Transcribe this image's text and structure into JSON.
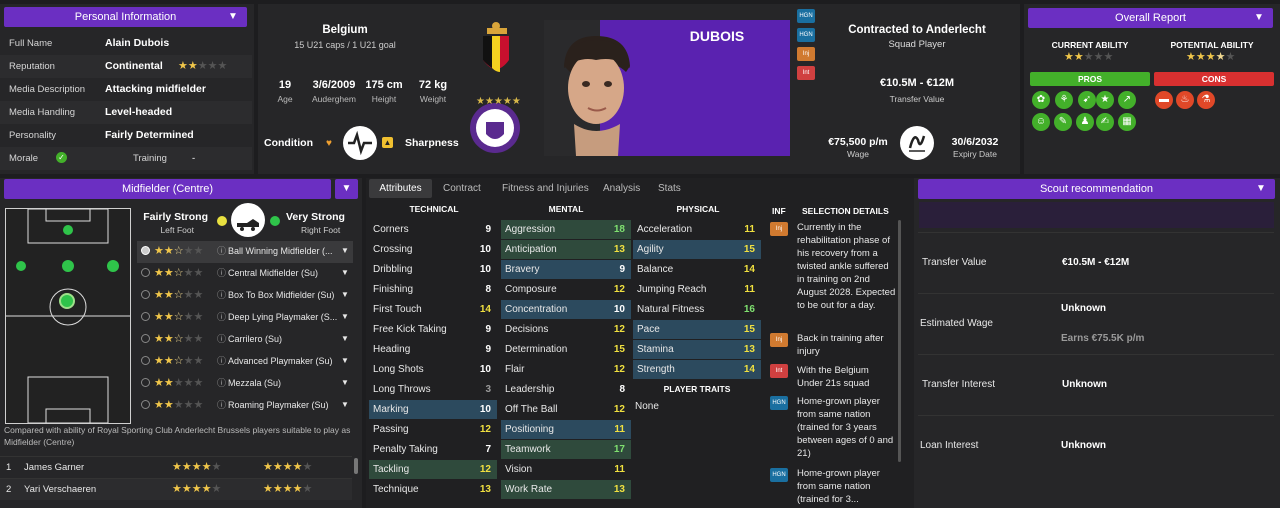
{
  "personal": {
    "title": "Personal Information",
    "rows": [
      {
        "k": "Full Name",
        "v": "Alain Dubois"
      },
      {
        "k": "Reputation",
        "v": "Continental"
      },
      {
        "k": "Media Description",
        "v": "Attacking midfielder"
      },
      {
        "k": "Media Handling",
        "v": "Level-headed"
      },
      {
        "k": "Personality",
        "v": "Fairly Determined"
      }
    ],
    "morale_label": "Morale",
    "training_label": "Training",
    "training_value": "-"
  },
  "header": {
    "nation": "Belgium",
    "caps": "15 U21 caps / 1 U21 goal",
    "age": "19",
    "age_label": "Age",
    "dob": "3/6/2009",
    "birthplace": "Auderghem",
    "height": "175 cm",
    "height_label": "Height",
    "weight": "72 kg",
    "weight_label": "Weight",
    "condition_label": "Condition",
    "sharpness_label": "Sharpness",
    "surname": "DUBOIS",
    "contract": "Contracted to Anderlecht",
    "squad": "Squad Player",
    "value": "€10.5M - €12M",
    "value_label": "Transfer Value",
    "wage": "€75,500 p/m",
    "wage_label": "Wage",
    "expiry": "30/6/2032",
    "expiry_label": "Expiry Date",
    "badges": [
      "HGN",
      "HGN",
      "Inj",
      "Int"
    ]
  },
  "report": {
    "title": "Overall Report",
    "ca_label": "CURRENT ABILITY",
    "pa_label": "POTENTIAL ABILITY",
    "pros_label": "PROS",
    "cons_label": "CONS",
    "ca_stars": 2,
    "pa_stars": 3.5
  },
  "position": {
    "title": "Midfielder (Centre)",
    "left_foot_level": "Fairly Strong",
    "left_foot": "Left Foot",
    "right_foot_level": "Very Strong",
    "right_foot": "Right Foot",
    "roles": [
      {
        "name": "Ball Winning Midfielder (...",
        "stars": 2.5
      },
      {
        "name": "Central Midfielder (Su)",
        "stars": 2.5
      },
      {
        "name": "Box To Box Midfielder (Su)",
        "stars": 2.5
      },
      {
        "name": "Deep Lying Playmaker (S...",
        "stars": 2.5
      },
      {
        "name": "Carrilero (Su)",
        "stars": 2.5
      },
      {
        "name": "Advanced Playmaker (Su)",
        "stars": 2.5
      },
      {
        "name": "Mezzala (Su)",
        "stars": 2
      },
      {
        "name": "Roaming Playmaker (Su)",
        "stars": 2
      }
    ],
    "compare": "Compared with ability of Royal Sporting Club Anderlecht Brussels players suitable to play as Midfielder (Centre)",
    "comparisons": [
      {
        "rank": "1",
        "name": "James Garner",
        "a": 4,
        "b": 4
      },
      {
        "rank": "2",
        "name": "Yari Verschaeren",
        "a": 4,
        "b": 4
      }
    ]
  },
  "tabs": [
    "Attributes",
    "Contract",
    "Fitness and Injuries",
    "Analysis",
    "Stats"
  ],
  "attributes": {
    "tech_title": "TECHNICAL",
    "mental_title": "MENTAL",
    "phys_title": "PHYSICAL",
    "traits_title": "PLAYER TRAITS",
    "traits": "None",
    "technical": [
      [
        "Corners",
        "9"
      ],
      [
        "Crossing",
        "10"
      ],
      [
        "Dribbling",
        "10"
      ],
      [
        "Finishing",
        "8"
      ],
      [
        "First Touch",
        "14"
      ],
      [
        "Free Kick Taking",
        "9"
      ],
      [
        "Heading",
        "9"
      ],
      [
        "Long Shots",
        "10"
      ],
      [
        "Long Throws",
        "3"
      ],
      [
        "Marking",
        "10"
      ],
      [
        "Passing",
        "12"
      ],
      [
        "Penalty Taking",
        "7"
      ],
      [
        "Tackling",
        "12"
      ],
      [
        "Technique",
        "13"
      ]
    ],
    "mental": [
      [
        "Aggression",
        "18"
      ],
      [
        "Anticipation",
        "13"
      ],
      [
        "Bravery",
        "9"
      ],
      [
        "Composure",
        "12"
      ],
      [
        "Concentration",
        "10"
      ],
      [
        "Decisions",
        "12"
      ],
      [
        "Determination",
        "15"
      ],
      [
        "Flair",
        "12"
      ],
      [
        "Leadership",
        "8"
      ],
      [
        "Off The Ball",
        "12"
      ],
      [
        "Positioning",
        "11"
      ],
      [
        "Teamwork",
        "17"
      ],
      [
        "Vision",
        "11"
      ],
      [
        "Work Rate",
        "13"
      ]
    ],
    "physical": [
      [
        "Acceleration",
        "11"
      ],
      [
        "Agility",
        "15"
      ],
      [
        "Balance",
        "14"
      ],
      [
        "Jumping Reach",
        "11"
      ],
      [
        "Natural Fitness",
        "16"
      ],
      [
        "Pace",
        "15"
      ],
      [
        "Stamina",
        "13"
      ],
      [
        "Strength",
        "14"
      ]
    ]
  },
  "selection": {
    "inf_label": "INF",
    "title": "SELECTION DETAILS",
    "items": [
      {
        "badge": "Inj",
        "text": "Currently in the rehabilitation phase of his recovery from a twisted ankle suffered in training on 2nd August 2028. Expected to be out for a day."
      },
      {
        "badge": "Inj",
        "text": "Back in training after injury"
      },
      {
        "badge": "Int",
        "text": "With the Belgium Under 21s squad"
      },
      {
        "badge": "HGN",
        "text": "Home-grown player from same nation (trained for 3 years between ages of 0 and 21)"
      },
      {
        "badge": "HGN",
        "text": "Home-grown player from same nation (trained for 3..."
      }
    ]
  },
  "scout": {
    "title": "Scout recommendation",
    "rows": [
      {
        "k": "Transfer Value",
        "v": "€10.5M - €12M",
        "v2": ""
      },
      {
        "k": "Estimated Wage",
        "v": "Unknown",
        "v2": "Earns €75.5K p/m"
      },
      {
        "k": "Transfer Interest",
        "v": "Unknown",
        "v2": ""
      },
      {
        "k": "Loan Interest",
        "v": "Unknown",
        "v2": ""
      }
    ]
  }
}
